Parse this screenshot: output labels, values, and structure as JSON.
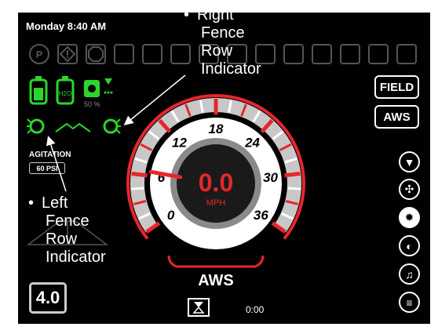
{
  "header": {
    "day_time": "Monday 8:40 AM"
  },
  "status": {
    "fill_percent": "50 %"
  },
  "agitation": {
    "label": "AGITATION",
    "value": "60 PSI"
  },
  "buttons": {
    "field": "FIELD",
    "aws": "AWS"
  },
  "gauge": {
    "speed": "0.0",
    "unit": "MPH",
    "mode": "AWS",
    "ticks": [
      "0",
      "6",
      "12",
      "18",
      "24",
      "30",
      "36"
    ],
    "needle_value": 6.5,
    "max": 36
  },
  "rate_box": {
    "value": "4.0"
  },
  "timer": {
    "value": "0:00"
  },
  "annotations": {
    "right_fence": [
      "Right",
      "Fence",
      "Row",
      "Indicator"
    ],
    "left_fence": [
      "Left",
      "Fence",
      "Row",
      "Indicator"
    ]
  },
  "colors": {
    "accent_red": "#e8262a",
    "active_green": "#2bd62b",
    "background": "#000000"
  }
}
